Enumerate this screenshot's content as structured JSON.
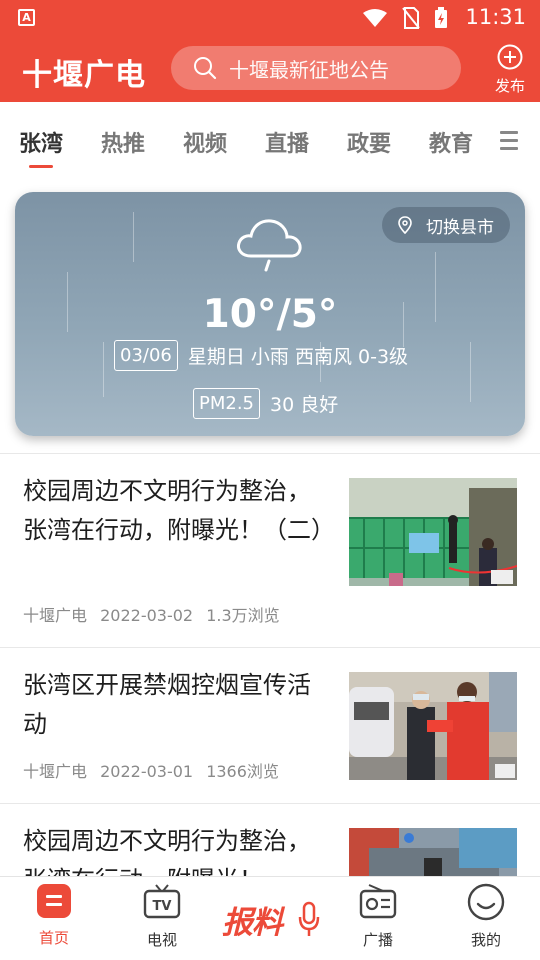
{
  "status_bar": {
    "time": "11:31",
    "app_icon_letter": "A"
  },
  "header": {
    "brand": "十堰广电",
    "search_placeholder": "十堰最新征地公告",
    "publish_label": "发布"
  },
  "tabs": [
    {
      "label": "张湾",
      "active": true
    },
    {
      "label": "热推"
    },
    {
      "label": "视频"
    },
    {
      "label": "直播"
    },
    {
      "label": "政要"
    },
    {
      "label": "教育"
    }
  ],
  "weather": {
    "switch_label": "切换县市",
    "temperature": "10°/5°",
    "date": "03/06",
    "detail": "星期日 小雨 西南风 0-3级",
    "pm_label": "PM2.5",
    "pm_value": "30 良好"
  },
  "news": [
    {
      "title": "校园周边不文明行为整治，张湾在行动，附曝光！（二）",
      "source": "十堰广电",
      "date": "2022-03-02",
      "views": "1.3万浏览"
    },
    {
      "title": "张湾区开展禁烟控烟宣传活动",
      "source": "十堰广电",
      "date": "2022-03-01",
      "views": "1366浏览"
    },
    {
      "title": "校园周边不文明行为整治，张湾在行动，附曝光！"
    }
  ],
  "bottom_nav": {
    "home": "首页",
    "tv": "电视",
    "report": "报料",
    "radio": "广播",
    "mine": "我的"
  },
  "colors": {
    "brand": "#ec4a39"
  }
}
